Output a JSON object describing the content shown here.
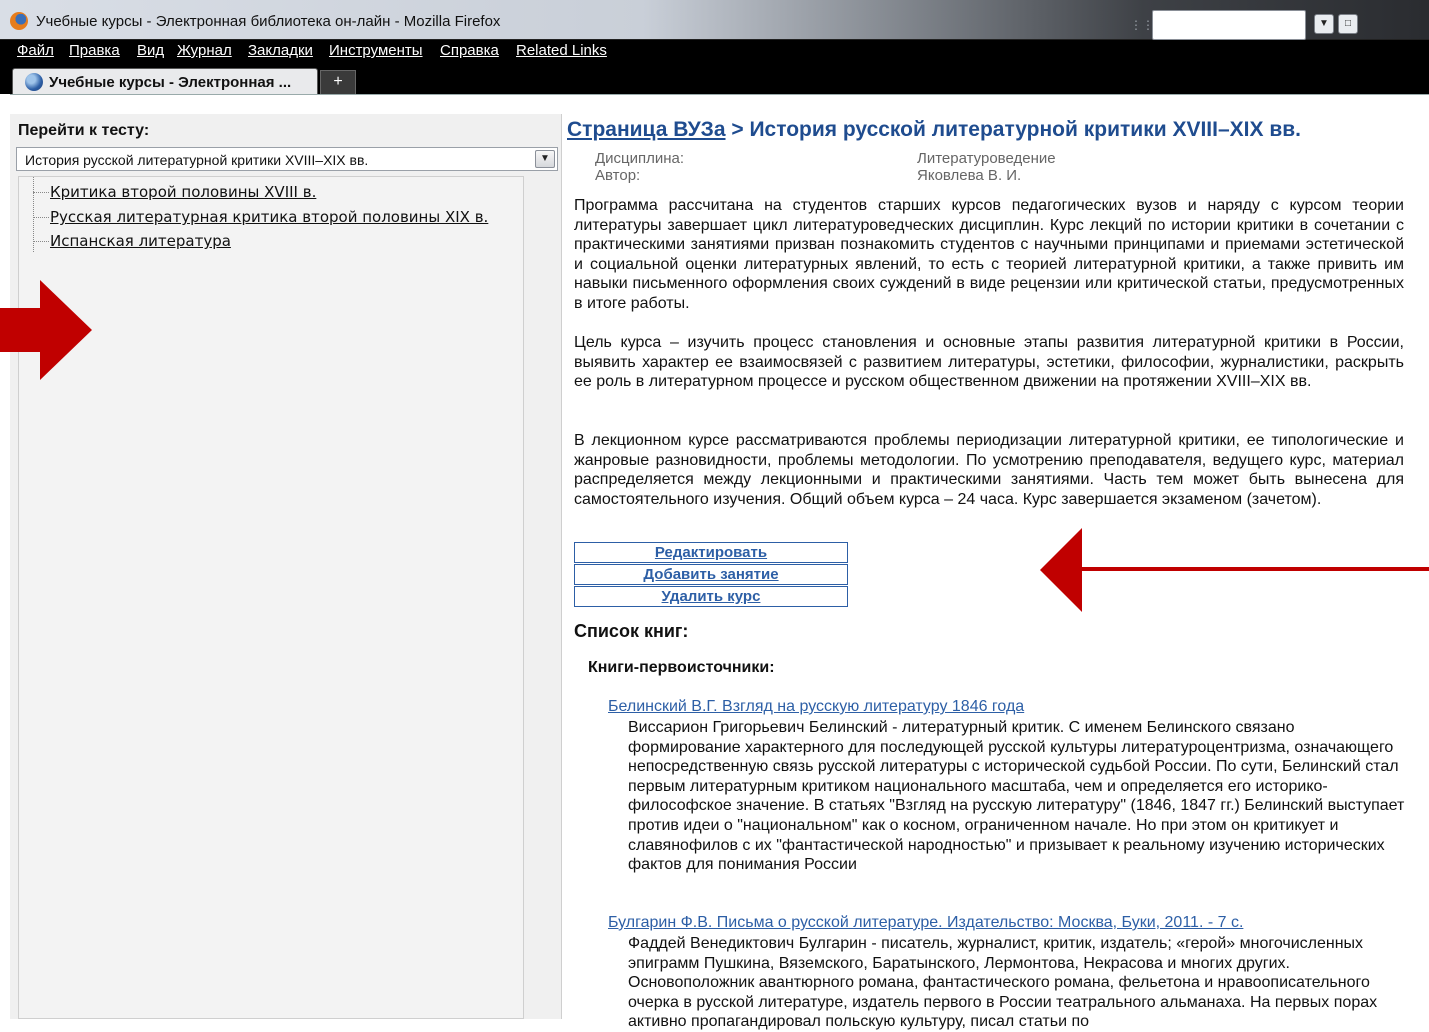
{
  "window": {
    "title": "Учебные курсы - Электронная библиотека он-лайн - Mozilla Firefox"
  },
  "menu": {
    "items": [
      "Файл",
      "Правка",
      "Вид",
      "Журнал",
      "Закладки",
      "Инструменты",
      "Справка",
      "Related Links"
    ]
  },
  "tabs": {
    "active_label": "Учебные курсы - Электронная ...",
    "new_tab_label": "+"
  },
  "left_panel": {
    "goto_label": "Перейти к тесту:",
    "selected_test": "История русской литературной критики XVIII–XIX вв.",
    "tree_items": [
      "Критика второй половины XVIII в.",
      "Русская литературная критика второй половины XIX в.",
      "Испанская литература"
    ]
  },
  "main": {
    "breadcrumb_link": "Страница ВУЗа",
    "breadcrumb_sep": " > ",
    "breadcrumb_title": "История русской литературной критики XVIII–XIX вв.",
    "discipline_label": "Дисциплина:",
    "discipline_value": "Литературоведение",
    "author_label": "Автор:",
    "author_value": "Яковлева В. И.",
    "paragraphs": [
      "Программа рассчитана на студентов старших курсов педагогических вузов и наряду с курсом теории литературы завершает цикл литературоведческих дисциплин. Курс лекций по истории критики в сочетании с практическими занятиями призван познакомить студентов с научными принципами и приемами эстетической и социальной оценки литературных явлений, то есть с теорией литературной критики, а также привить им навыки письменного оформления своих суждений в виде рецензии или критической статьи, предусмотренных в итоге работы.",
      "Цель курса – изучить процесс становления и основные этапы развития литературной критики в России, выявить характер ее взаимосвязей с развитием литературы, эстетики, философии, журналистики, раскрыть ее роль в литературном процессе и русском общественном движении на протяжении XVIII–XIX вв.",
      "В лекционном курсе рассматриваются проблемы периодизации литературной критики, ее типологические и жанровые разновидности, проблемы методологии. По усмотрению преподавателя, ведущего курс, материал распределяется между лекционными и практическими занятиями. Часть тем может быть вынесена для самостоятельного изучения. Общий объем курса – 24 часа. Курс завершается экзаменом (зачетом)."
    ],
    "buttons": {
      "edit": "Редактировать",
      "add_lesson": "Добавить занятие",
      "delete_course": "Удалить курс"
    },
    "booklist_title": "Список книг:",
    "booklist_subtitle": "Книги-первоисточники:",
    "books": [
      {
        "link": "Белинский В.Г. Взгляд на русскую литературу 1846 года",
        "desc": "Виссарион Григорьевич Белинский - литературный критик. С именем Белинского связано формирование характерного для последующей русской культуры литературоцентризма, означающего непосредственную связь русской литературы с исторической судьбой России. По сути, Белинский стал первым литературным критиком национального масштаба, чем и определяется его историко-философское значение. В статьях \"Взгляд на русскую литературу\" (1846, 1847 гг.) Белинский выступает против идеи о \"национальном\" как о косном, ограниченном начале. Но при этом он критикует и славянофилов с их \"фантастической народностью\" и призывает к реальному изучению исторических фактов для понимания России"
      },
      {
        "link": "Булгарин Ф.В. Письма о русской литературе. Издательство: Москва, Буки, 2011. - 7 с.",
        "desc": "Фаддей Венедиктович Булгарин - писатель, журналист, критик, издатель; «герой» многочисленных эпиграмм Пушкина, Вяземского, Баратынского, Лермонтова, Некрасова и многих других. Основоположник авантюрного романа, фантастического романа, фельетона и нравоописательного очерка в русской литературе, издатель первого в России театрального альманаха. На первых порах активно пропагандировал польскую культуру, писал статьи по"
      }
    ]
  },
  "colors": {
    "link_blue": "#2d5fa6",
    "title_blue": "#1f4c8f",
    "annotation_red": "#c00000"
  }
}
